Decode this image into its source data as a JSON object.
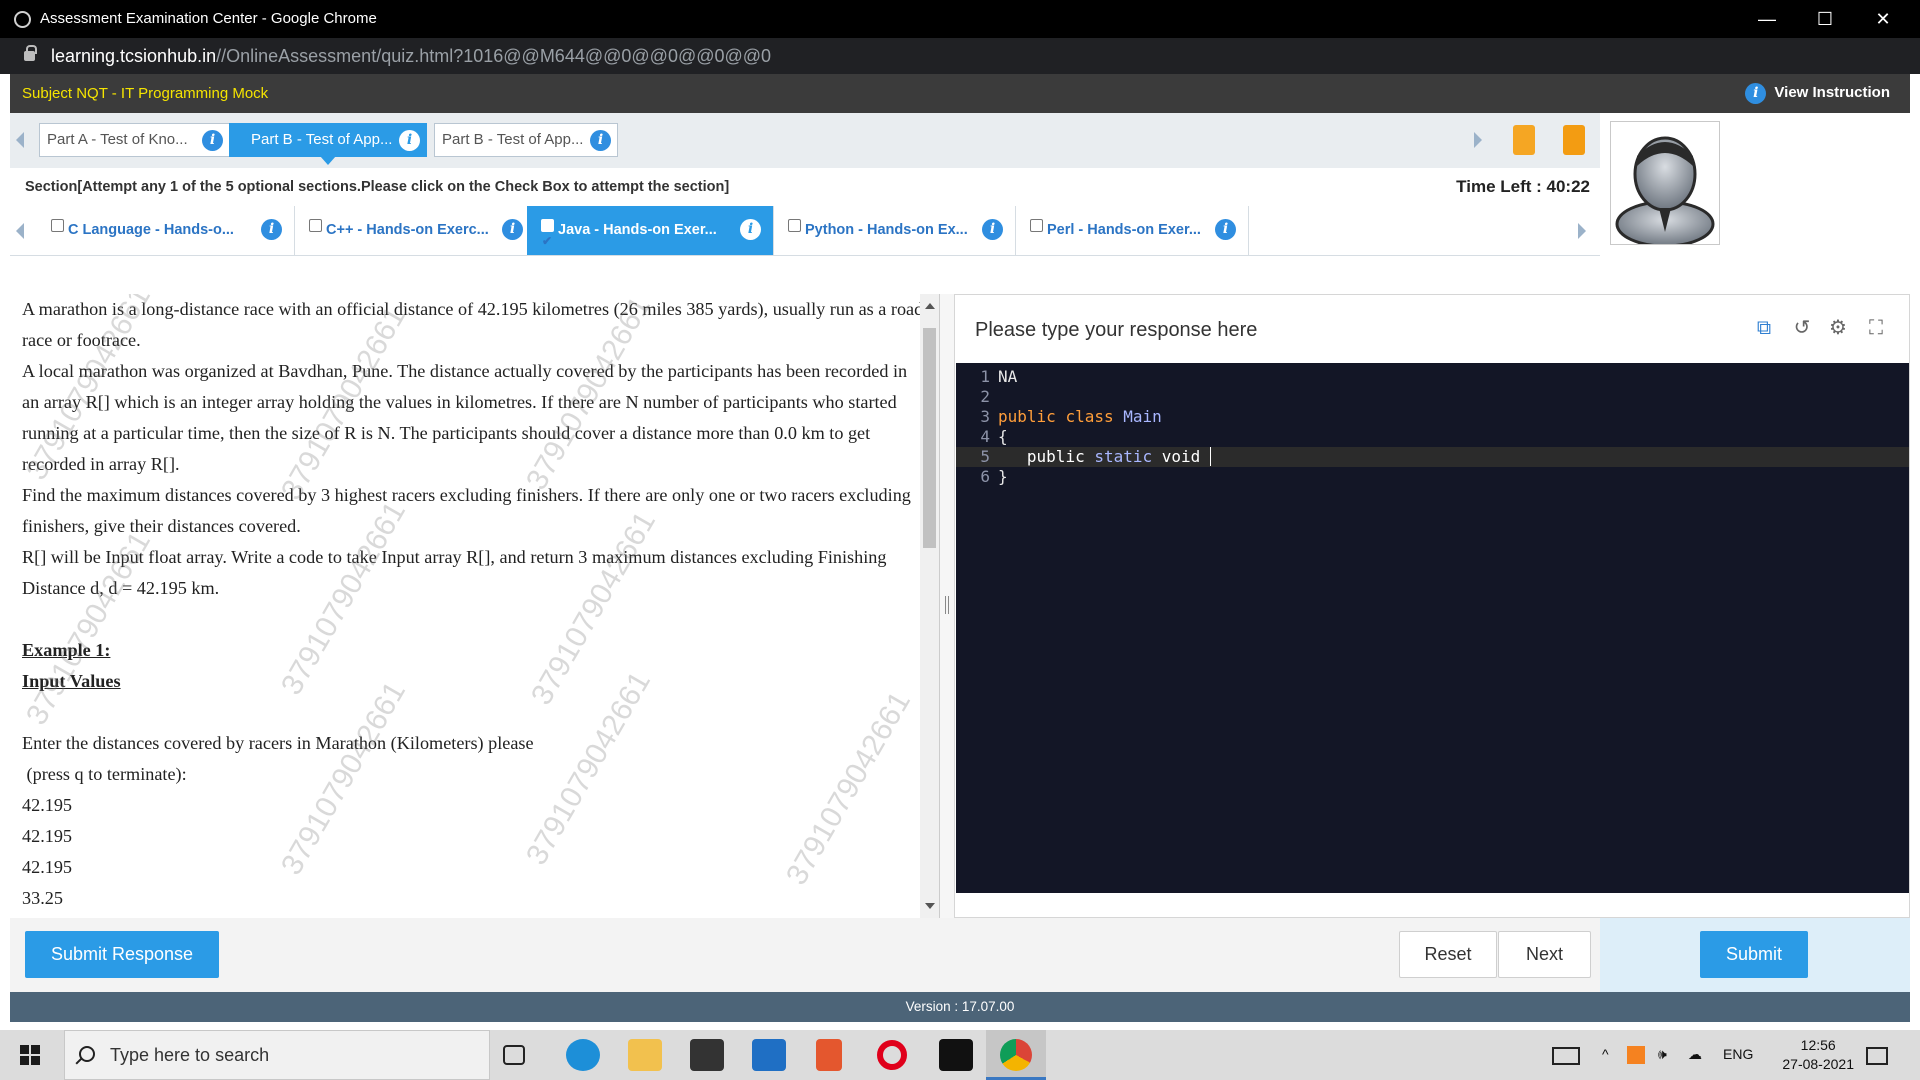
{
  "window": {
    "title": "Assessment Examination Center - Google Chrome",
    "url_host": "learning.tcsionhub.in",
    "url_path": "//OnlineAssessment/quiz.html?1016@@M644@@0@@0@@0@@0"
  },
  "header": {
    "subject": "Subject NQT - IT Programming Mock",
    "view_instruction": "View Instruction"
  },
  "parts": [
    {
      "label": "Part A - Test of Kno..."
    },
    {
      "label": "Part B - Test of App..."
    },
    {
      "label": "Part B - Test of App..."
    }
  ],
  "section": {
    "instruction": "Section[Attempt any 1 of the 5 optional sections.Please click on the Check Box to attempt the section]",
    "time_left": "Time Left : 40:22"
  },
  "optional_sections": [
    {
      "label": "C Language - Hands-o...",
      "checked": false
    },
    {
      "label": "C++ - Hands-on Exerc...",
      "checked": false
    },
    {
      "label": "Java - Hands-on Exer...",
      "checked": true
    },
    {
      "label": "Python - Hands-on Ex...",
      "checked": false
    },
    {
      "label": "Perl - Hands-on Exer...",
      "checked": false
    }
  ],
  "question": {
    "paragraphs": [
      "A marathon is a long-distance race with an official distance of 42.195 kilometres (26 miles 385 yards), usually run as a road race or footrace.",
      "A local marathon was organized at Bavdhan, Pune. The distance actually covered by the participants has been recorded in an array R[] which is an integer array holding the values in kilometres. If there are N number of participants who started running at a particular time, then the size of R is N. The participants should cover a distance more than 0.0 km to get recorded in array R[].",
      "Find the maximum distances covered by 3 highest racers excluding finishers. If there are only one or two racers excluding finishers, give their distances covered.",
      "R[] will be Input float array. Write a code to take Input array R[], and return 3 maximum distances excluding Finishing Distance d, d = 42.195 km."
    ],
    "example_heading": "Example 1:",
    "input_values_heading": "Input Values",
    "prompt_line1": "Enter the distances covered by racers in Marathon (Kilometers) please",
    "prompt_line2": " (press q to terminate):",
    "values": [
      "42.195",
      "42.195",
      "42.195",
      "33.25"
    ],
    "watermark": "379107904266​1"
  },
  "response": {
    "title": "Please type your response here",
    "code_lines": [
      {
        "n": "1",
        "text": "NA"
      },
      {
        "n": "2",
        "text": ""
      },
      {
        "n": "3",
        "text": "public class Main"
      },
      {
        "n": "4",
        "text": "{"
      },
      {
        "n": "5",
        "text": "   public static void "
      },
      {
        "n": "6",
        "text": "}"
      }
    ]
  },
  "buttons": {
    "submit_response": "Submit Response",
    "reset": "Reset",
    "next": "Next",
    "submit": "Submit"
  },
  "version": "Version : 17.07.00",
  "taskbar": {
    "search_placeholder": "Type here to search",
    "language": "ENG",
    "time": "12:56",
    "date": "27-08-2021"
  },
  "colors": {
    "accent": "#2b9be6",
    "header_bg": "#3b3b3b",
    "subject_text": "#f5e400",
    "editor_bg": "#131626"
  }
}
